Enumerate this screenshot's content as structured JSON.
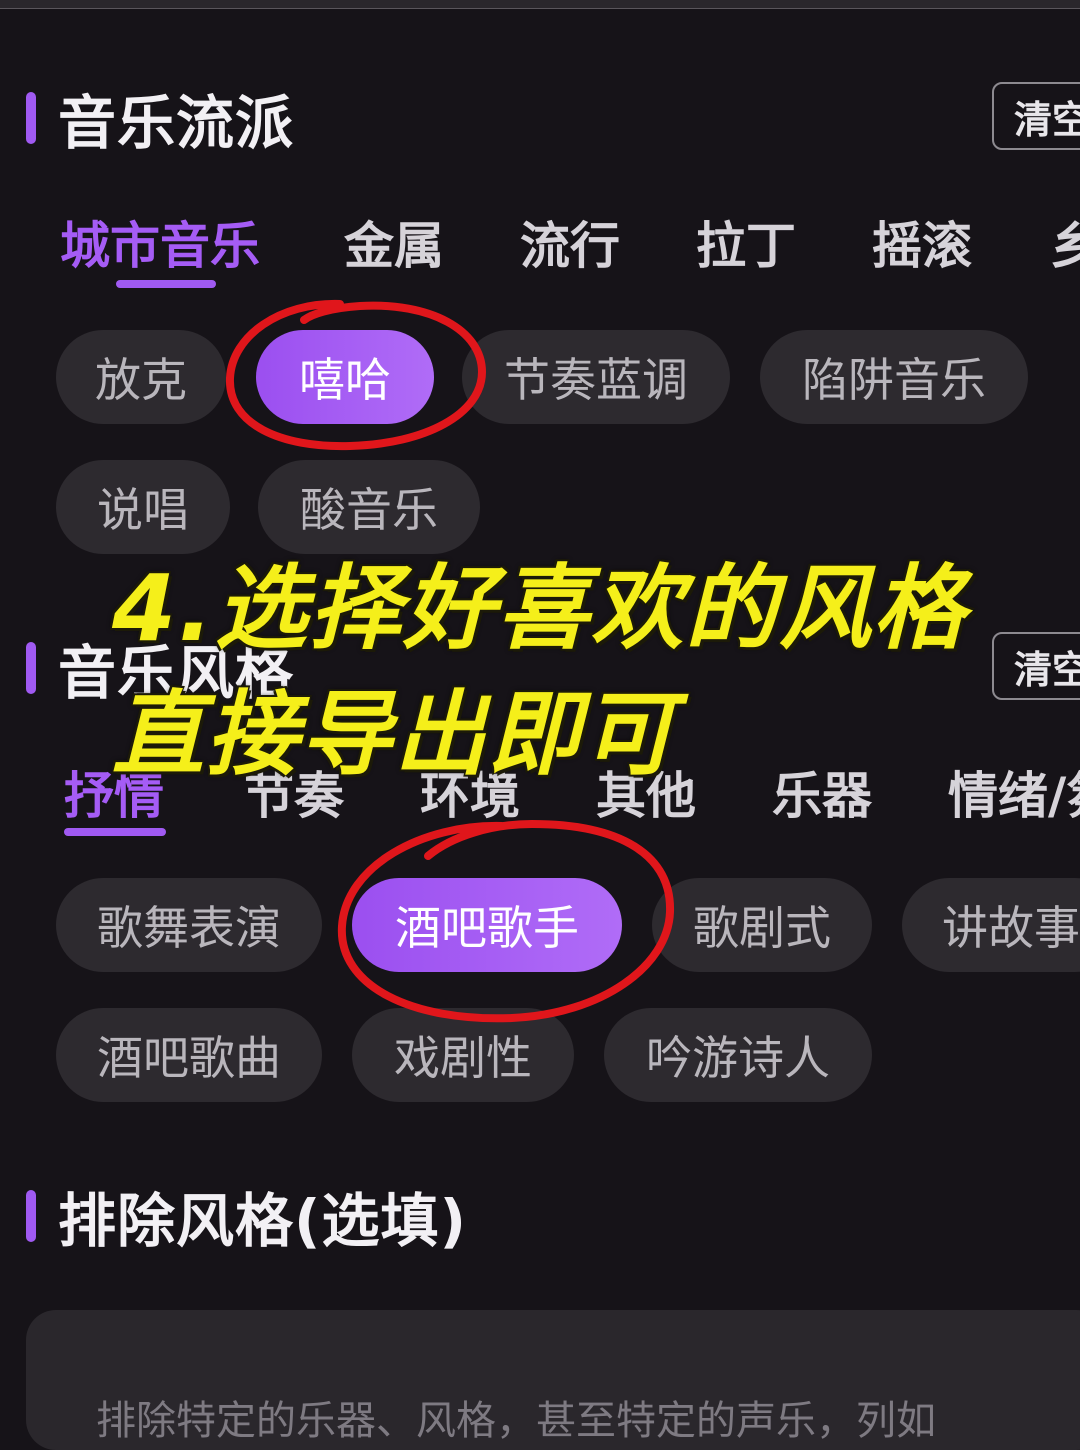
{
  "sections": {
    "genre": {
      "title": "音乐流派",
      "clear_label": "清空",
      "tabs": [
        "城市音乐",
        "金属",
        "流行",
        "拉丁",
        "摇滚",
        "乡"
      ],
      "chips": [
        "放克",
        "嘻哈",
        "节奏蓝调",
        "陷阱音乐",
        "说唱",
        "酸音乐"
      ],
      "selected_chip": "嘻哈"
    },
    "style": {
      "title": "音乐风格",
      "clear_label": "清空",
      "tabs": [
        "抒情",
        "节奏",
        "环境",
        "其他",
        "乐器",
        "情绪/氛"
      ],
      "chips": [
        "歌舞表演",
        "酒吧歌手",
        "歌剧式",
        "讲故事",
        "酒吧歌曲",
        "戏剧性",
        "吟游诗人"
      ],
      "selected_chip": "酒吧歌手"
    },
    "exclude": {
      "title": "排除风格(选填)",
      "placeholder": "排除特定的乐器、风格，甚至特定的声乐，列如"
    }
  },
  "overlay": {
    "line1": "4.选择好喜欢的风格",
    "line2": "直接导出即可"
  },
  "colors": {
    "accent": "#a05af2",
    "background": "#161318",
    "chip": "#2d2a2f",
    "annotation_red": "#e0161b",
    "overlay_yellow": "#f5ef1a"
  }
}
